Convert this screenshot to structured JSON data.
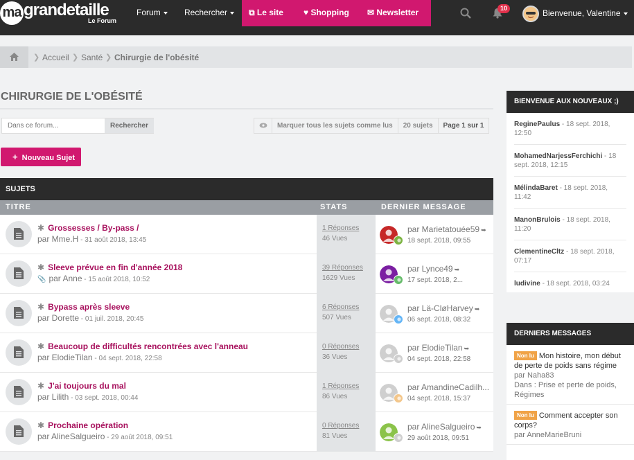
{
  "brand": {
    "logo_circle": "ma",
    "logo_text": "grandetaille",
    "logo_sub": "Le Forum"
  },
  "nav": {
    "forum": "Forum",
    "search": "Rechercher",
    "site": "Le site",
    "shopping": "Shopping",
    "newsletter": "Newsletter",
    "notifications_count": "10",
    "welcome": "Bienvenue, Valentine"
  },
  "breadcrumb": [
    "Accueil",
    "Santé",
    "Chirurgie de l'obésité"
  ],
  "page": {
    "title": "CHIRURGIE DE L'OBÉSITÉ",
    "search_placeholder": "Dans ce forum...",
    "search_button": "Rechercher",
    "mark_read": "Marquer tous les sujets comme lus",
    "topic_count": "20 sujets",
    "pagination": "Page 1 sur 1",
    "new_topic": "Nouveau Sujet"
  },
  "table": {
    "header": "SUJETS",
    "col_title": "TITRE",
    "col_stats": "STATS",
    "col_last": "DERNIER MESSAGE",
    "rows": [
      {
        "title": "Grossesses / By-pass /",
        "author": "par Mme.H",
        "date": " - 31 août 2018, 13:45",
        "replies": "1 Réponses",
        "views": "46 Vues",
        "last_user": "par Marietatouée59",
        "last_date": "18 sept. 2018, 09:55",
        "attachment": false
      },
      {
        "title": "Sleeve prévue en fin d'année 2018",
        "author": "par Anne",
        "date": " - 15 août 2018, 10:52",
        "replies": "39 Réponses",
        "views": "1629 Vues",
        "last_user": "par Lynce49",
        "last_date": "17 sept. 2018, 2...",
        "attachment": true
      },
      {
        "title": "Bypass après sleeve",
        "author": "par Dorette",
        "date": " - 01 juil. 2018, 20:45",
        "replies": "6 Réponses",
        "views": "507 Vues",
        "last_user": "par Lä-CløHarvey",
        "last_date": "06 sept. 2018, 08:32",
        "attachment": false
      },
      {
        "title": "Beaucoup de difficultés rencontrées avec l'anneau",
        "author": "par ElodieTilan",
        "date": " - 04 sept. 2018, 22:58",
        "replies": "0 Réponses",
        "views": "36 Vues",
        "last_user": "par ElodieTilan",
        "last_date": "04 sept. 2018, 22:58",
        "attachment": false
      },
      {
        "title": "J'ai toujours du mal",
        "author": "par Lilith",
        "date": " - 03 sept. 2018, 00:44",
        "replies": "1 Réponses",
        "views": "86 Vues",
        "last_user": "par AmandineCadilh...",
        "last_date": "04 sept. 2018, 15:37",
        "attachment": false
      },
      {
        "title": "Prochaine opération",
        "author": "par AlineSalgueiro",
        "date": " - 29 août 2018, 09:51",
        "replies": "0 Réponses",
        "views": "81 Vues",
        "last_user": "par AlineSalgueiro",
        "last_date": "29 août 2018, 09:51",
        "attachment": false
      }
    ]
  },
  "sidebar": {
    "welcome_title": "BIENVENUE AUX NOUVEAUX ;)",
    "members": [
      {
        "name": "ReginePaulus",
        "date": " - 18 sept. 2018, 12:50"
      },
      {
        "name": "MohamedNarjessFerchichi",
        "date": " - 18 sept. 2018, 12:15"
      },
      {
        "name": "MélindaBaret",
        "date": " - 18 sept. 2018, 11:42"
      },
      {
        "name": "ManonBrulois",
        "date": " - 18 sept. 2018, 11:20"
      },
      {
        "name": "ClementineCltz",
        "date": " - 18 sept. 2018, 07:17"
      },
      {
        "name": "ludivine",
        "date": " - 18 sept. 2018, 03:24"
      }
    ],
    "latest_title": "DERNIERS MESSAGES",
    "latest": [
      {
        "badge": "Non lu",
        "title": "Mon histoire, mon début de perte de poids sans régime",
        "author": "par Naha83",
        "forum": "Dans : Prise et perte de poids, Régimes"
      },
      {
        "badge": "Non lu",
        "title": "Comment accepter son corps?",
        "author": "par AnneMarieBruni",
        "forum": ""
      }
    ]
  },
  "colors": {
    "pink": "#d1186f",
    "dark": "#2b2b2b",
    "badge_orange": "#f0a347",
    "link": "#a8125e"
  }
}
